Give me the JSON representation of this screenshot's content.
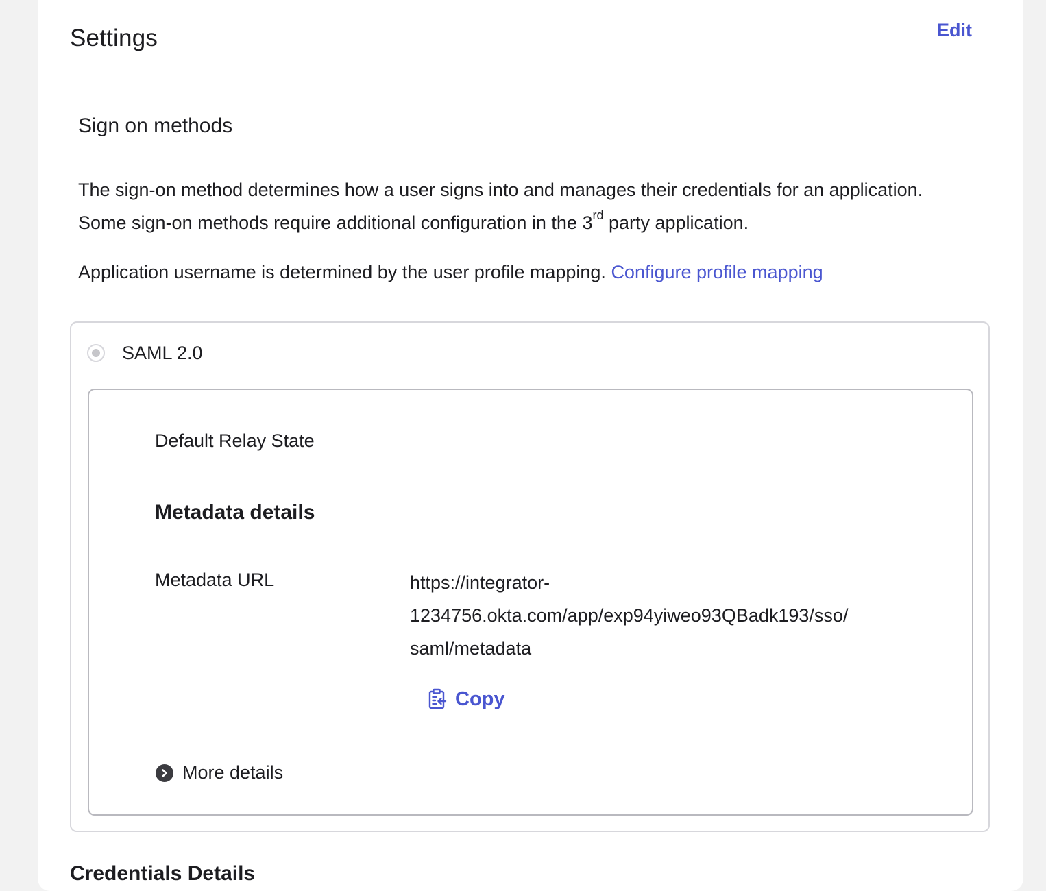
{
  "header": {
    "title": "Settings",
    "edit_label": "Edit"
  },
  "sign_on": {
    "section_title": "Sign on methods",
    "description_part1": "The sign-on method determines how a user signs into and manages their credentials for an application. Some sign-on methods require additional configuration in the 3",
    "description_sup": "rd",
    "description_part2": " party application.",
    "mapping_text": "Application username is determined by the user profile mapping. ",
    "mapping_link": "Configure profile mapping"
  },
  "method": {
    "label": "SAML 2.0",
    "selected": true,
    "relay_state_label": "Default Relay State",
    "metadata_title": "Metadata details",
    "metadata_url_label": "Metadata URL",
    "metadata_url_line1": "https://integrator-",
    "metadata_url_line2": "1234756.okta.com/app/exp94yiweo93QBadk193/sso/",
    "metadata_url_line3": "saml/metadata",
    "copy_label": "Copy",
    "copy_icon": "clipboard-copy-icon",
    "more_details_label": "More details",
    "more_details_icon": "chevron-right-circle-icon"
  },
  "next_section": {
    "title": "Credentials Details"
  },
  "colors": {
    "accent": "#4a56d0",
    "text": "#1d1d21",
    "background": "#f2f2f2",
    "card": "#ffffff",
    "border": "#d7d7dc"
  }
}
